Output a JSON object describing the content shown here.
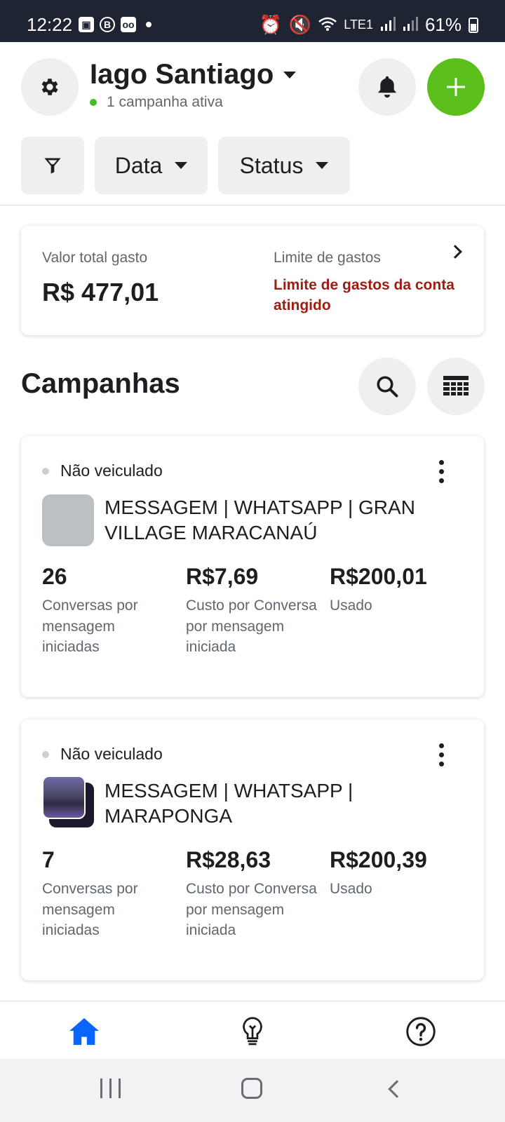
{
  "status_bar": {
    "time": "12:22",
    "battery": "61%",
    "network": "LTE1"
  },
  "header": {
    "account_name": "Iago Santiago",
    "campaign_status": "1 campanha ativa",
    "icons": [
      "gear-icon",
      "bell-icon",
      "plus-icon"
    ]
  },
  "filters": {
    "date_label": "Data",
    "status_label": "Status"
  },
  "spend": {
    "total_label": "Valor total gasto",
    "total_value": "R$ 477,01",
    "limit_label": "Limite de gastos",
    "limit_warning": "Limite de gastos da conta atingido"
  },
  "campaigns": {
    "title": "Campanhas",
    "items": [
      {
        "status": "Não veiculado",
        "name": "MESSAGEM | WHATSAPP | GRAN VILLAGE MARACANAÚ",
        "metrics": [
          {
            "value": "26",
            "label": "Conversas por mensagem iniciadas"
          },
          {
            "value": "R$7,69",
            "label": "Custo por Conversa por mensagem iniciada"
          },
          {
            "value": "R$200,01",
            "label": "Usado"
          }
        ]
      },
      {
        "status": "Não veiculado",
        "name": "MESSAGEM | WHATSAPP | MARAPONGA",
        "metrics": [
          {
            "value": "7",
            "label": "Conversas por mensagem iniciadas"
          },
          {
            "value": "R$28,63",
            "label": "Custo por Conversa por mensagem iniciada"
          },
          {
            "value": "R$200,39",
            "label": "Usado"
          }
        ]
      }
    ]
  },
  "bottom_nav": {
    "items": [
      "home-icon",
      "lightbulb-icon",
      "help-icon"
    ],
    "active": "home-icon"
  },
  "colors": {
    "accent_blue": "#0866ff",
    "add_green": "#5abf1a",
    "warning_red": "#9f1d10",
    "status_bar": "#1f2433"
  }
}
